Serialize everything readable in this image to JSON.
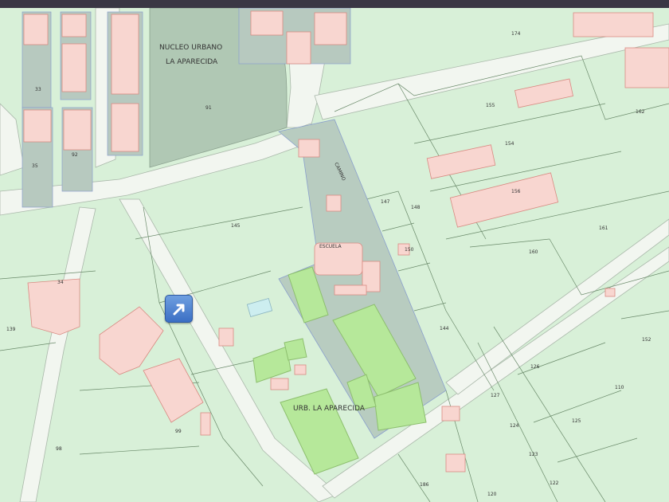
{
  "map": {
    "labels": {
      "nucleo_line1": "NUCLEO URBANO",
      "nucleo_line2": "LA APARECIDA",
      "parcel_91": "91",
      "urb": "URB. LA APARECIDA",
      "escuela": "ESCUELA",
      "camino": "CAMINO",
      "p174": "174",
      "p155": "155",
      "p162": "162",
      "p154": "154",
      "p156": "156",
      "p161": "161",
      "p160": "160",
      "p147": "147",
      "p148": "148",
      "p145": "145",
      "p150": "150",
      "p144": "144",
      "p34": "34",
      "p99": "99",
      "p98": "98",
      "p139": "139",
      "p152": "152",
      "p110": "110",
      "p126": "126",
      "p127": "127",
      "p125": "125",
      "p124": "124",
      "p123": "123",
      "p122": "122",
      "p120": "120",
      "p186": "186",
      "p35": "35",
      "p33": "33",
      "p92": "92"
    }
  },
  "colors": {
    "parcel_fill": "#d8f0d8",
    "urban_fill": "#b0c8b4",
    "building_fill": "#f8d6d0",
    "building_stroke": "#d98a82",
    "field_fill": "#b6e89a",
    "road_fill": "#f2f6f0",
    "button_blue": "#4a7fd0"
  },
  "icons": {
    "directions_button": "arrow-up-right-icon"
  }
}
